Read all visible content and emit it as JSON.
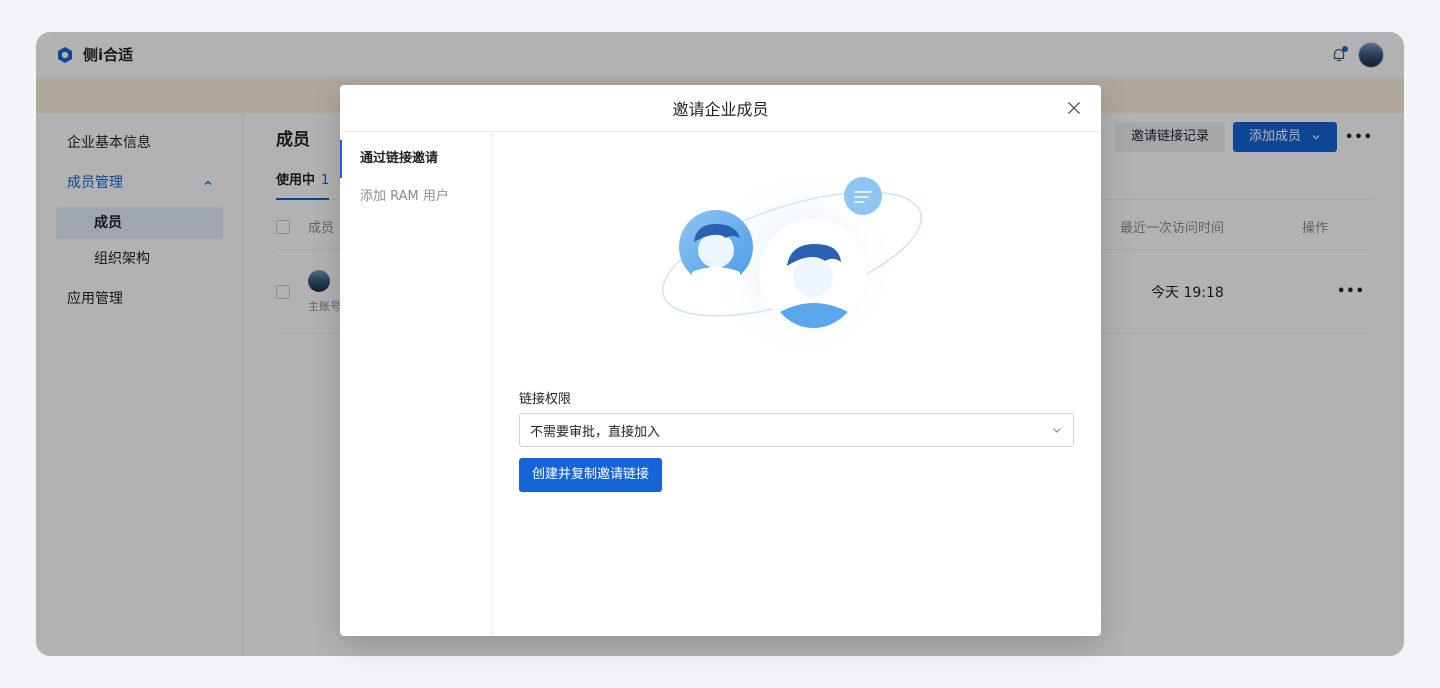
{
  "app": {
    "name": "侧i合适"
  },
  "sidebar": {
    "items": [
      {
        "label": "企业基本信息"
      },
      {
        "label": "成员管理"
      },
      {
        "label": "成员"
      },
      {
        "label": "组织架构"
      },
      {
        "label": "应用管理"
      }
    ]
  },
  "main": {
    "title": "成员",
    "actions": {
      "invite_log": "邀请链接记录",
      "add_member": "添加成员"
    },
    "tabs": [
      {
        "label": "使用中",
        "count": "1"
      }
    ],
    "columns": {
      "member": "成员",
      "last_visit": "最近一次访问时间",
      "ops": "操作"
    },
    "rows": [
      {
        "tag": "主账号",
        "last_visit": "今天 19:18"
      }
    ]
  },
  "modal": {
    "title": "邀请企业成员",
    "nav": [
      {
        "label": "通过链接邀请"
      },
      {
        "label": "添加 RAM 用户"
      }
    ],
    "permission_label": "链接权限",
    "permission_value": "不需要审批，直接加入",
    "create_button": "创建并复制邀请链接"
  },
  "colors": {
    "accent": "#1565d8",
    "banner": "#fcefdf",
    "selected_bg": "#e6eefb"
  }
}
